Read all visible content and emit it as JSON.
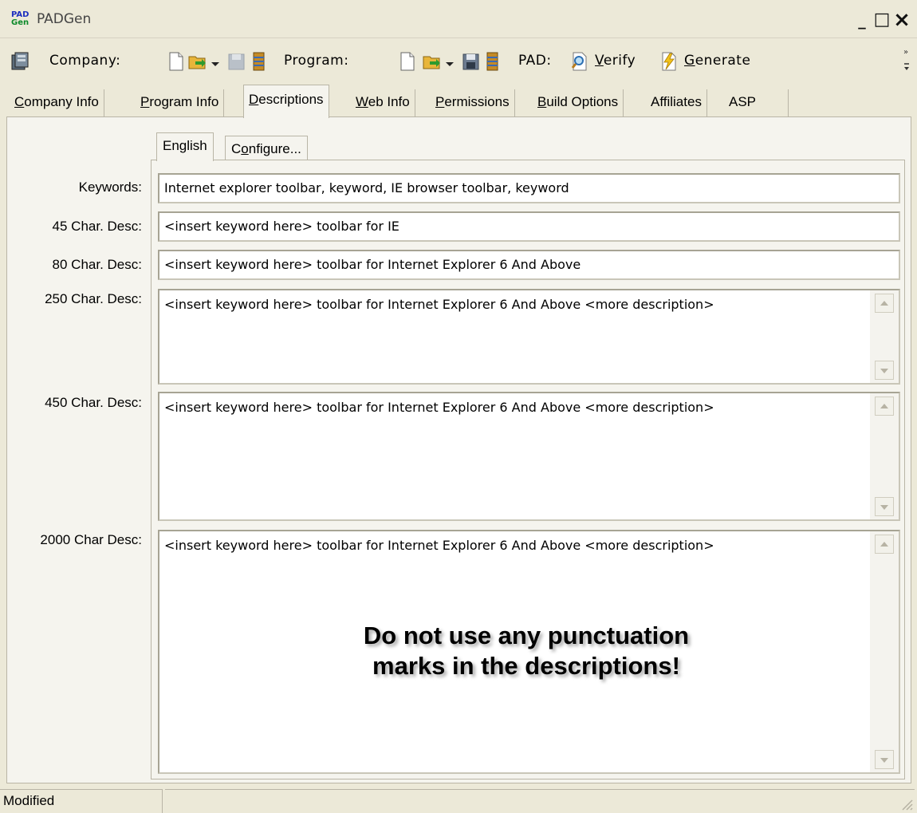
{
  "window": {
    "logo_line1": "PAD",
    "logo_line2": "Gen",
    "title": "PADGen",
    "minimize": "_",
    "maximize": "□",
    "close": "×"
  },
  "toolbar": {
    "company_label": "Company:",
    "program_label": "Program:",
    "pad_label": "PAD:",
    "verify_accel": "V",
    "verify_rest": "erify",
    "generate_accel": "G",
    "generate_rest": "enerate"
  },
  "main_tabs": [
    {
      "accel": "C",
      "rest": "ompany Info"
    },
    {
      "accel": "P",
      "rest": "rogram Info"
    },
    {
      "accel": "D",
      "rest": "escriptions"
    },
    {
      "accel": "W",
      "rest": "eb Info"
    },
    {
      "accel": "P",
      "rest": "ermissions"
    },
    {
      "accel": "B",
      "rest": "uild Options"
    },
    {
      "accel": "",
      "rest": "Affiliates"
    },
    {
      "accel": "",
      "rest": "ASP"
    }
  ],
  "sub_tabs": {
    "english": "English",
    "configure_pre": "C",
    "configure_accel": "o",
    "configure_rest": "nfigure..."
  },
  "fields": {
    "keywords": {
      "label": "Keywords:",
      "value": "Internet explorer toolbar, keyword, IE browser toolbar, keyword"
    },
    "desc45": {
      "label": "45 Char. Desc:",
      "value": "<insert keyword here> toolbar for IE"
    },
    "desc80": {
      "label": "80 Char. Desc:",
      "value": "<insert keyword here> toolbar for Internet Explorer 6 And Above"
    },
    "desc250": {
      "label": "250 Char. Desc:",
      "value": "<insert keyword here> toolbar for Internet Explorer 6 And Above  <more description>"
    },
    "desc450": {
      "label": "450 Char. Desc:",
      "value": "<insert keyword here> toolbar for Internet Explorer 6 And Above  <more description>"
    },
    "desc2000": {
      "label": "2000 Char Desc:",
      "value": "<insert keyword here> toolbar for Internet Explorer 6 And Above  <more description>"
    }
  },
  "warning": {
    "line1": "Do not use any punctuation",
    "line2": "marks in the descriptions!"
  },
  "status": {
    "left": "Modified"
  },
  "icons": [
    "app-logo-icon",
    "database-icon",
    "new-file-icon",
    "open-folder-icon",
    "save-icon",
    "publish-icon",
    "verify-magnifier-icon",
    "generate-lightning-icon",
    "toolbar-overflow-icon",
    "resize-grip-icon"
  ],
  "colors": {
    "window_bg": "#ece9d8",
    "panel_bg": "#f5f4ee",
    "field_bg": "#ffffff"
  }
}
